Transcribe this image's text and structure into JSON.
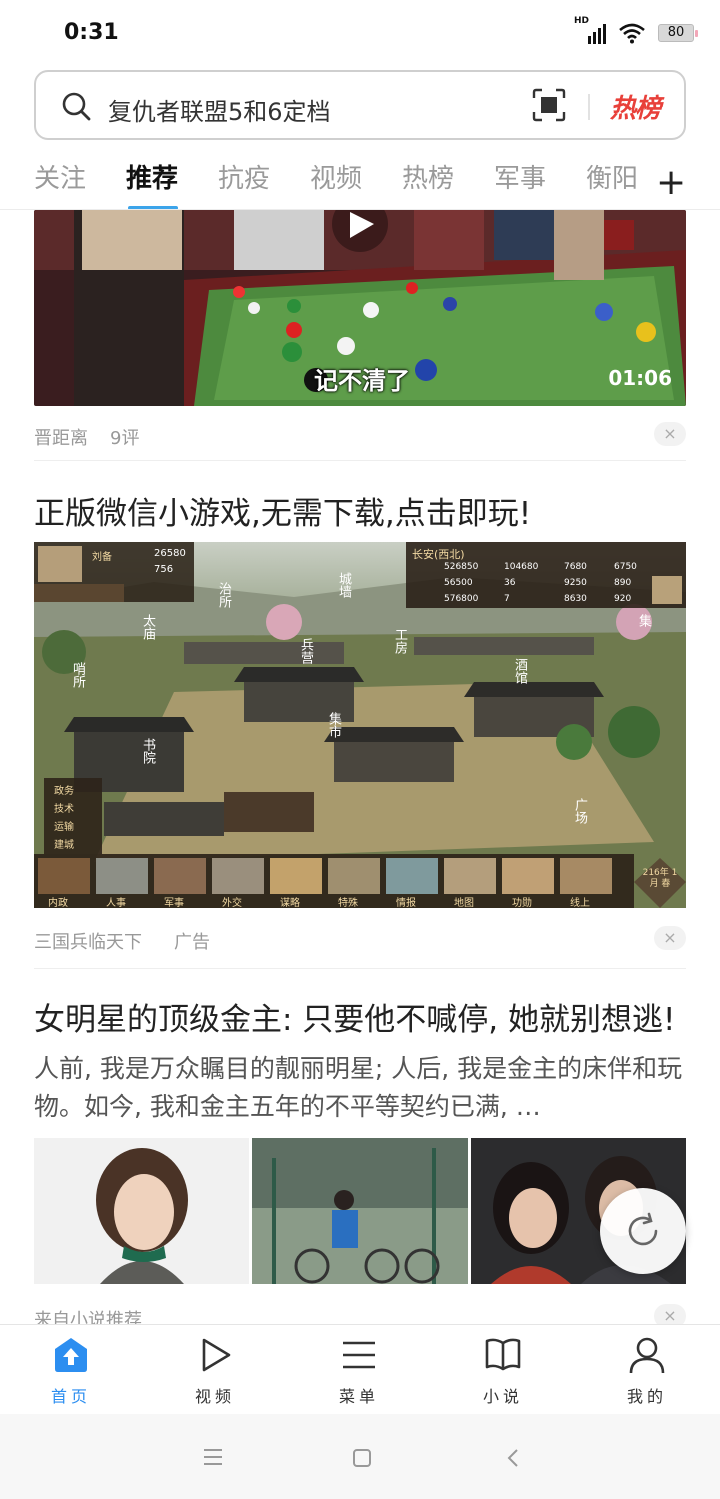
{
  "status_bar": {
    "time": "0:31",
    "network": "HD",
    "battery": "80"
  },
  "search": {
    "placeholder": "复仇者联盟5和6定档",
    "hot_label": "热榜"
  },
  "tabs": [
    {
      "label": "关注",
      "active": false
    },
    {
      "label": "推荐",
      "active": true
    },
    {
      "label": "抗疫",
      "active": false
    },
    {
      "label": "视频",
      "active": false
    },
    {
      "label": "热榜",
      "active": false
    },
    {
      "label": "军事",
      "active": false
    },
    {
      "label": "衡阳",
      "active": false
    }
  ],
  "feed": {
    "video_item": {
      "subtitle": "记不清了",
      "duration": "01:06",
      "source": "晋距离",
      "comments": "9评"
    },
    "ad_item": {
      "title": "正版微信小游戏,无需下载,点击即玩!",
      "source": "三国兵临天下",
      "tag": "广告",
      "game_hud": {
        "city": "长安(西北)",
        "player": "刘备",
        "stats_left": [
          "26580",
          "756"
        ],
        "stats_right": [
          "526850",
          "104680",
          "7680",
          "6750",
          "56500",
          "36",
          "9250",
          "890",
          "576800",
          "7",
          "8630",
          "920"
        ],
        "labels": [
          "城墙",
          "治所",
          "太庙",
          "工房",
          "兵营",
          "集市",
          "酒馆",
          "哨所",
          "书院",
          "广场",
          "集"
        ],
        "side_menu": [
          "政务",
          "技术",
          "运输",
          "建城"
        ],
        "bottom_menu": [
          "内政",
          "人事",
          "军事",
          "外交",
          "谋略",
          "特殊",
          "情报",
          "地图",
          "功勋",
          "线上"
        ],
        "date": "216年 1月 春"
      }
    },
    "article_item": {
      "title": "女明星的顶级金主: 只要他不喊停, 她就别想逃!",
      "summary": "人前, 我是万众瞩目的靓丽明星; 人后, 我是金主的床伴和玩物。如今, 我和金主五年的不平等契约已满, …",
      "source": "来自小说推荐"
    }
  },
  "bottom_nav": [
    {
      "label": "首页",
      "icon": "home-icon",
      "active": true
    },
    {
      "label": "视频",
      "icon": "play-icon",
      "active": false
    },
    {
      "label": "菜单",
      "icon": "menu-icon",
      "active": false
    },
    {
      "label": "小说",
      "icon": "book-icon",
      "active": false
    },
    {
      "label": "我的",
      "icon": "user-icon",
      "active": false
    }
  ],
  "colors": {
    "accent": "#2c8ef0",
    "hot": "#e8403a",
    "tab_underline": "#3ba4ea"
  }
}
